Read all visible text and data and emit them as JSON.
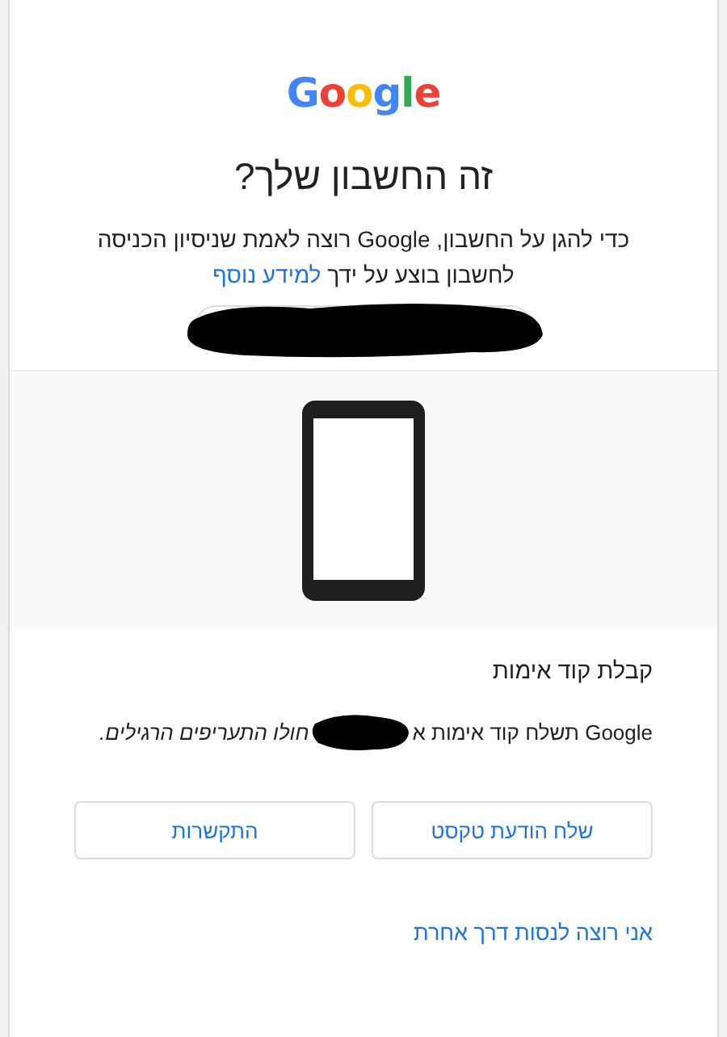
{
  "logo": "Google",
  "title": "זה החשבון שלך?",
  "description": {
    "text": "כדי להגן על החשבון, Google רוצה לאמת שניסיון הכניסה לחשבון בוצע על ידך",
    "link": "למידע נוסף"
  },
  "option": {
    "heading": "קבלת קוד אימות",
    "text_start": "Google תשלח קוד אימות א",
    "text_end": "חולו התעריפים הרגילים."
  },
  "buttons": [
    {
      "label": "שלח הודעת טקסט"
    },
    {
      "label": "התקשרות"
    }
  ],
  "other_way_link": "אני רוצה לנסות דרך אחרת"
}
